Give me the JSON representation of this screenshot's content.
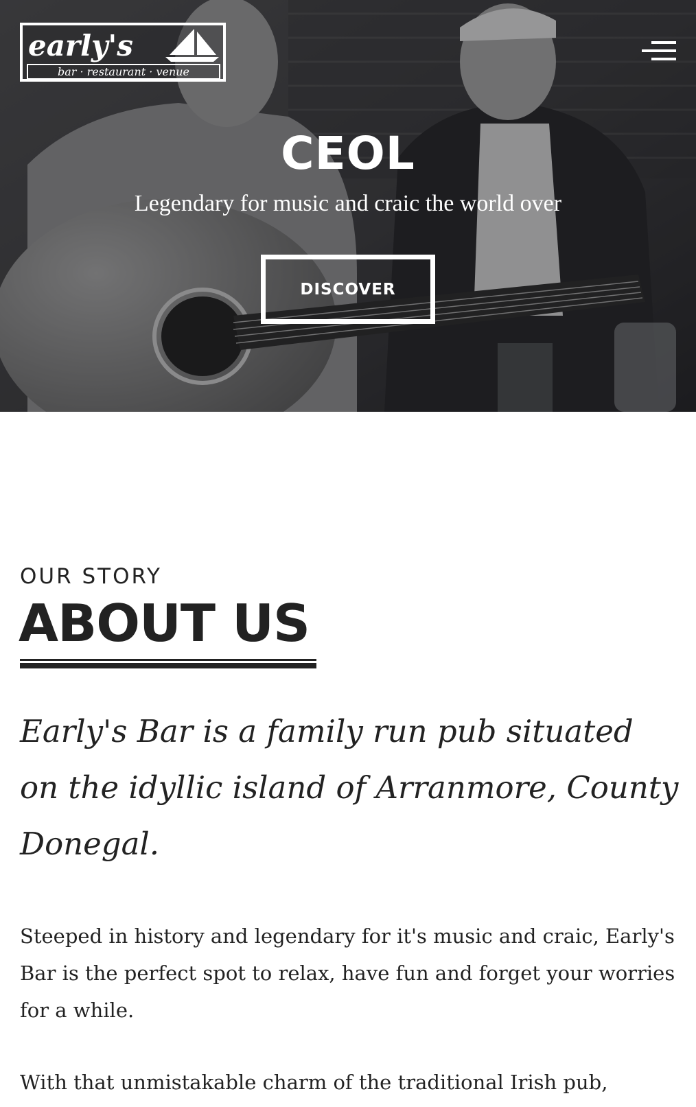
{
  "header": {
    "logo": {
      "wordmark": "early's",
      "tagline": "bar · restaurant · venue"
    },
    "menu_icon": "hamburger-icon"
  },
  "hero": {
    "title": "CEOL",
    "subtitle": "Legendary for music and craic the world over",
    "cta_label": "DISCOVER"
  },
  "about": {
    "eyebrow": "OUR STORY",
    "title": "ABOUT US",
    "lead": "Early's Bar is a family run pub situated on the idyllic island of Arranmore, County Donegal.",
    "paragraphs": [
      "Steeped in history and legendary for it's music and craic, Early's Bar is the perfect spot to relax, have fun and forget your worries for a while.",
      "With that unmistakable charm of the traditional Irish pub,"
    ]
  },
  "colors": {
    "text": "#222222",
    "background": "#ffffff",
    "hero_overlay": "#2a2a2c",
    "on_hero": "#ffffff"
  }
}
